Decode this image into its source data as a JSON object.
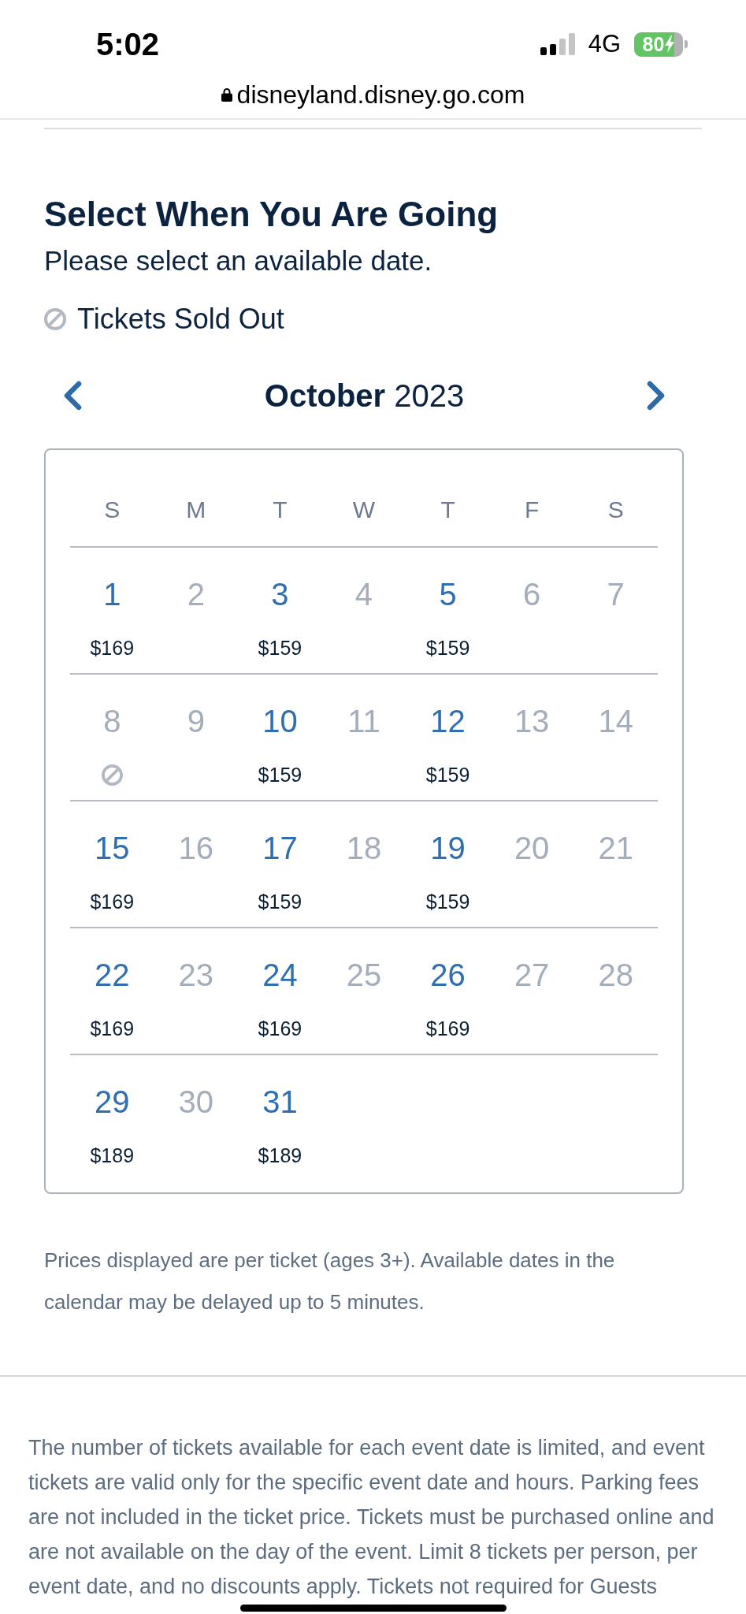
{
  "status_bar": {
    "time": "5:02",
    "network": "4G",
    "battery": "80"
  },
  "browser": {
    "url": "disneyland.disney.go.com"
  },
  "header": {
    "title": "Select When You Are Going",
    "subtitle": "Please select an available date."
  },
  "legend": [
    {
      "kind": "sold_out",
      "label": "Tickets Sold Out"
    }
  ],
  "calendar": {
    "month": "**October** 2023",
    "weekdays": [
      "S",
      "M",
      "T",
      "W",
      "T",
      "F",
      "S"
    ],
    "weeks": [
      [
        {
          "day": "1",
          "kind": "available",
          "price": "$169"
        },
        {
          "day": "2",
          "kind": "unavailable"
        },
        {
          "day": "3",
          "kind": "available",
          "price": "$159"
        },
        {
          "day": "4",
          "kind": "unavailable"
        },
        {
          "day": "5",
          "kind": "available",
          "price": "$159"
        },
        {
          "day": "6",
          "kind": "unavailable"
        },
        {
          "day": "7",
          "kind": "unavailable"
        }
      ],
      [
        {
          "day": "8",
          "kind": "sold_out"
        },
        {
          "day": "9",
          "kind": "unavailable"
        },
        {
          "day": "10",
          "kind": "available",
          "price": "$159"
        },
        {
          "day": "11",
          "kind": "unavailable"
        },
        {
          "day": "12",
          "kind": "available",
          "price": "$159"
        },
        {
          "day": "13",
          "kind": "unavailable"
        },
        {
          "day": "14",
          "kind": "unavailable"
        }
      ],
      [
        {
          "day": "15",
          "kind": "available",
          "price": "$169"
        },
        {
          "day": "16",
          "kind": "unavailable"
        },
        {
          "day": "17",
          "kind": "available",
          "price": "$159"
        },
        {
          "day": "18",
          "kind": "unavailable"
        },
        {
          "day": "19",
          "kind": "available",
          "price": "$159"
        },
        {
          "day": "20",
          "kind": "unavailable"
        },
        {
          "day": "21",
          "kind": "unavailable"
        }
      ],
      [
        {
          "day": "22",
          "kind": "available",
          "price": "$169"
        },
        {
          "day": "23",
          "kind": "unavailable"
        },
        {
          "day": "24",
          "kind": "available",
          "price": "$169"
        },
        {
          "day": "25",
          "kind": "unavailable"
        },
        {
          "day": "26",
          "kind": "available",
          "price": "$169"
        },
        {
          "day": "27",
          "kind": "unavailable"
        },
        {
          "day": "28",
          "kind": "unavailable"
        }
      ],
      [
        {
          "day": "29",
          "kind": "available",
          "price": "$189"
        },
        {
          "day": "30",
          "kind": "unavailable"
        },
        {
          "day": "31",
          "kind": "available",
          "price": "$189"
        }
      ]
    ]
  },
  "note": "Prices displayed are per ticket (ages 3+). Available dates in the calendar may be delayed up to 5 minutes.",
  "terms": "The number of tickets available for each event date is limited, and event tickets are valid only for the specific event date and hours. Parking fees are not included in the ticket price. Tickets must be purchased online and are not available on the day of the event. Limit 8 tickets per person, per event date, and no discounts apply. Tickets not required for Guests"
}
